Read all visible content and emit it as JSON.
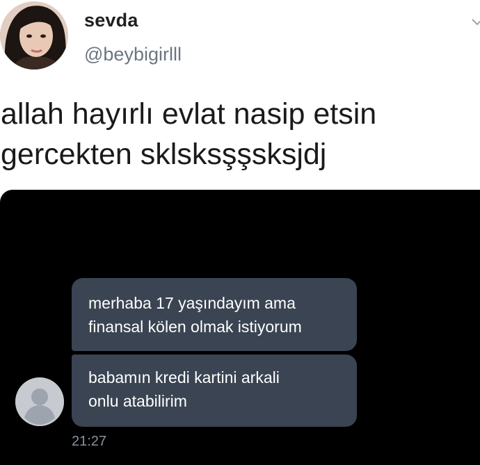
{
  "profile": {
    "display_name": "sevda",
    "handle": "@beybigirlll"
  },
  "tweet": {
    "lines": [
      "allah hayırlı evlat nasip etsin",
      "gercekten sklsksşşsksjdj"
    ]
  },
  "dm": {
    "messages": [
      {
        "lines": [
          "merhaba 17 yaşındayım ama",
          "finansal kölen olmak istiyorum"
        ]
      },
      {
        "lines": [
          "babamın kredi kartini arkali",
          "onlu atabilirim"
        ]
      }
    ],
    "timestamp": "21:27"
  },
  "icons": {
    "menu": "chevron-down-icon",
    "sender": "default-avatar-icon"
  },
  "colors": {
    "bubble": "#3a4452",
    "dm_background": "#000000",
    "handle_gray": "#6b7580"
  }
}
